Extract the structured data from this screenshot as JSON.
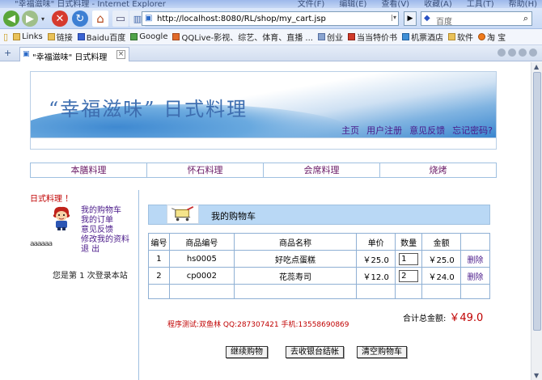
{
  "window": {
    "title": "\"幸福滋味\" 日式料理 - Internet Explorer",
    "menu": [
      "文件(F)",
      "编辑(E)",
      "查看(V)",
      "收藏(A)",
      "工具(T)",
      "帮助(H)"
    ]
  },
  "navbar": {
    "url": "http://localhost:8080/RL/shop/my_cart.jsp",
    "search_placeholder": "百度"
  },
  "favorites": [
    "Links",
    "链接",
    "Baidu百度",
    "Google",
    "QQLive-影视、综艺、体育、直播 ...",
    "创业",
    "当当特价书",
    "机票酒店",
    "软件",
    "淘 宝"
  ],
  "tab": {
    "label": "\"幸福滋味\" 日式料理"
  },
  "banner": {
    "title": "“幸福滋味” 日式料理",
    "links": [
      "主页",
      "用户注册",
      "意见反馈",
      "忘记密码?"
    ]
  },
  "categories": [
    "本膳料理",
    "怀石料理",
    "会席料理",
    "烧烤"
  ],
  "left": {
    "header": "日式料理 ！",
    "menu": [
      "我的购物车",
      "我的订单",
      "意见反馈",
      "修改我的资料",
      "退 出"
    ],
    "dots": "aaaaaa",
    "visit": "您是第 1 次登录本站"
  },
  "cart": {
    "title": "我的购物车",
    "columns": [
      "编号",
      "商品编号",
      "商品名称",
      "单价",
      "数量",
      "金额",
      ""
    ],
    "rows": [
      {
        "no": "1",
        "code": "hs0005",
        "name": "好吃点蛋糕",
        "price": "￥25.0",
        "qty": "1",
        "amount": "￥25.0",
        "del": "删除"
      },
      {
        "no": "2",
        "code": "cp0002",
        "name": "花蕊寿司",
        "price": "￥12.0",
        "qty": "2",
        "amount": "￥24.0",
        "del": "删除"
      }
    ],
    "total_label": "合计总金额:",
    "total_value": "￥49.0"
  },
  "tester": "程序测试:双鱼林 QQ:287307421 手机:13558690869",
  "buttons": [
    "继续购物",
    "去收银台结帐",
    "清空购物车"
  ]
}
